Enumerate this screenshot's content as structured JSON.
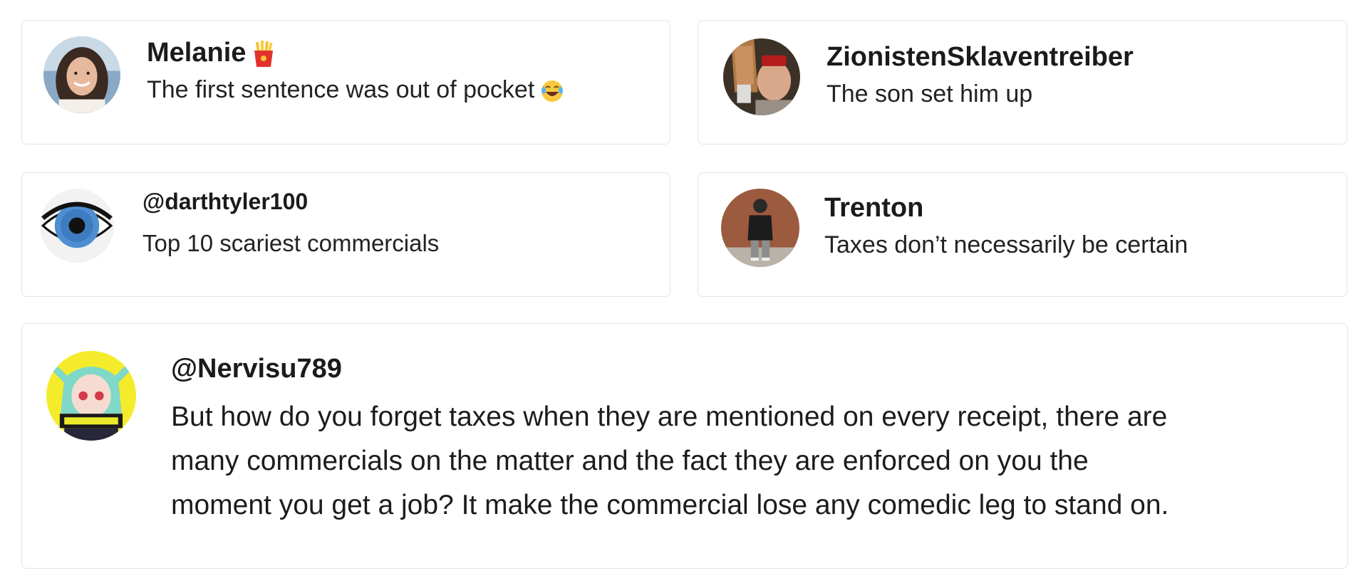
{
  "comments": [
    {
      "username": "Melanie",
      "username_emoji": "fries-emoji",
      "text": "The first sentence was out of pocket",
      "text_emoji": "laughing-tears-emoji"
    },
    {
      "username": "ZionistenSklaventreiber",
      "text": "The son set him up"
    },
    {
      "username": "@darthtyler100",
      "text": "Top 10 scariest commercials"
    },
    {
      "username": "Trenton",
      "text": "Taxes don’t necessarily be certain"
    },
    {
      "username": "@Nervisu789",
      "text_lines": [
        "But how do you forget taxes when they are mentioned on every receipt, there are",
        "many commercials on the matter and the fact they are enforced on you the",
        "moment you get a job? It make the commercial lose any comedic leg to stand on."
      ]
    }
  ]
}
